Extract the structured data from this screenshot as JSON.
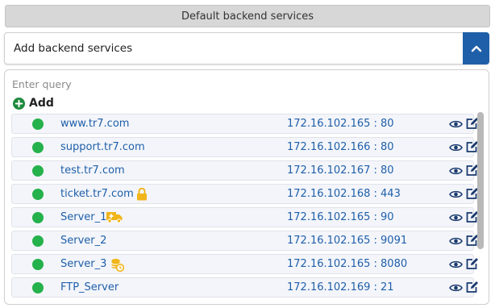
{
  "header": {
    "title": "Default backend services"
  },
  "section": {
    "title": "Add backend services"
  },
  "search": {
    "placeholder": "Enter query",
    "value": ""
  },
  "add": {
    "label": "Add"
  },
  "colors": {
    "accent": "#1f5fa9",
    "status_ok": "#25b14b",
    "badge": "#f1b51a"
  },
  "services": [
    {
      "name": "www.tr7.com",
      "address": "172.16.102.165 : 80",
      "status": "online",
      "badge": ""
    },
    {
      "name": "support.tr7.com",
      "address": "172.16.102.166 : 80",
      "status": "online",
      "badge": ""
    },
    {
      "name": "test.tr7.com",
      "address": "172.16.102.167 : 80",
      "status": "online",
      "badge": ""
    },
    {
      "name": "ticket.tr7.com",
      "address": "172.16.102.168 : 443",
      "status": "online",
      "badge": "lock-icon"
    },
    {
      "name": "Server_1",
      "address": "172.16.102.165 : 90",
      "status": "online",
      "badge": "ambulance-icon"
    },
    {
      "name": "Server_2",
      "address": "172.16.102.165 : 9091",
      "status": "online",
      "badge": ""
    },
    {
      "name": "Server_3",
      "address": "172.16.102.165 : 8080",
      "status": "online",
      "badge": "database-sync-icon"
    },
    {
      "name": "FTP_Server",
      "address": "172.16.102.169 : 21",
      "status": "online",
      "badge": ""
    }
  ]
}
